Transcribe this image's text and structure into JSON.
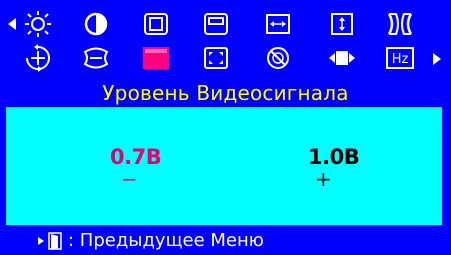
{
  "osd": {
    "title": "Уровень Видеосигнала",
    "footer_label": ": Предыдущее Меню",
    "min_value": "0.7B",
    "max_value": "1.0B",
    "minus_sign": "−",
    "plus_sign": "+"
  },
  "menu_icons": {
    "row1": [
      "brightness-icon",
      "contrast-icon",
      "h-position-icon",
      "v-position-icon",
      "h-size-icon",
      "v-size-icon",
      "pincushion-icon"
    ],
    "row2": [
      "rotation-icon",
      "trapezoid-icon",
      "video-level-icon",
      "moire-icon",
      "degauss-icon",
      "recall-icon",
      "hz-icon"
    ],
    "selected": "video-level-icon",
    "hz_text": "Hz"
  },
  "colors": {
    "background": "#0000ff",
    "panel": "#00ffff",
    "title": "#ffff00",
    "selected_value": "#e8006e",
    "selected_icon": "#ff0080",
    "text": "#ffffff"
  }
}
